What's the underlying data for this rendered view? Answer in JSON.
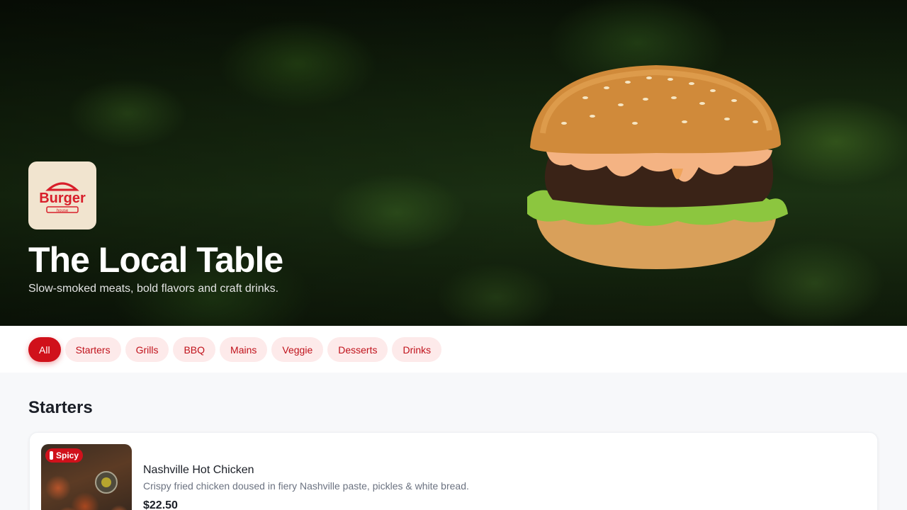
{
  "hero": {
    "title": "The Local Table",
    "subtitle": "Slow-smoked meats, bold flavors and craft drinks.",
    "logo": {
      "word": "Burger",
      "subword": "house"
    }
  },
  "categories": [
    {
      "label": "All",
      "active": true
    },
    {
      "label": "Starters",
      "active": false
    },
    {
      "label": "Grills",
      "active": false
    },
    {
      "label": "BBQ",
      "active": false
    },
    {
      "label": "Mains",
      "active": false
    },
    {
      "label": "Veggie",
      "active": false
    },
    {
      "label": "Desserts",
      "active": false
    },
    {
      "label": "Drinks",
      "active": false
    }
  ],
  "section": {
    "title": "Starters",
    "items": [
      {
        "badge": "Spicy",
        "name": "Nashville Hot Chicken",
        "description": "Crispy fried chicken doused in fiery Nashville paste, pickles & white bread.",
        "price": "$22.50"
      }
    ]
  },
  "colors": {
    "accent": "#d0111b",
    "pill_bg": "#fdeaea",
    "page_bg": "#f7f8fa"
  }
}
